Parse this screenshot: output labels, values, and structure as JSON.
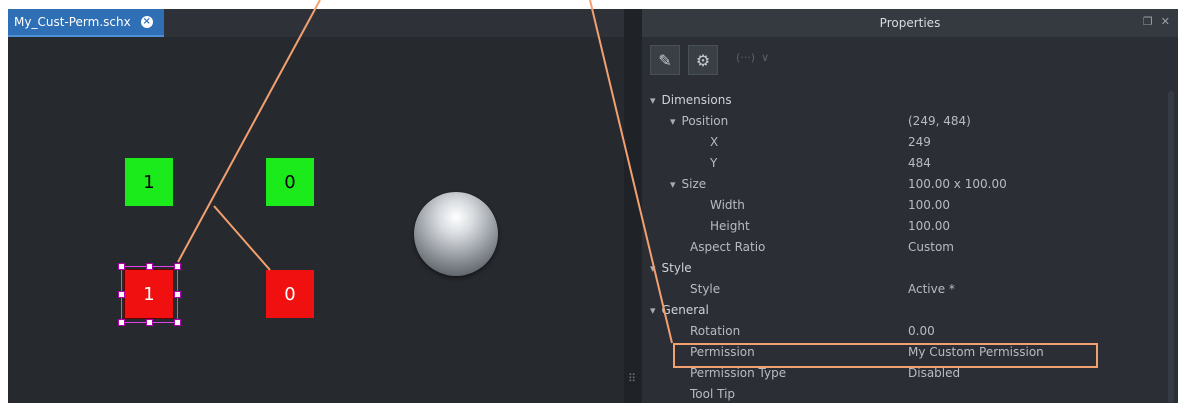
{
  "document_tab": {
    "label": "My_Cust-Perm.schx",
    "close_icon": "close-circle-icon"
  },
  "canvas": {
    "buttons": [
      {
        "label": "1",
        "color": "#1bea1b"
      },
      {
        "label": "0",
        "color": "#1bea1b"
      },
      {
        "label": "1",
        "color": "#f01010",
        "selected": true
      },
      {
        "label": "0",
        "color": "#f01010"
      }
    ],
    "orb_icon": "glass-sphere-icon"
  },
  "properties": {
    "title": "Properties",
    "header_icons": [
      "restore-icon",
      "close-icon"
    ],
    "toolbar": [
      "edit-properties-icon",
      "gear-settings-icon",
      "link-icon",
      "chevron-down-icon"
    ],
    "rows": [
      {
        "id": "dimensions",
        "name": "Dimensions",
        "value": "",
        "expander": "▾",
        "section": true
      },
      {
        "id": "position",
        "name": "Position",
        "value": "(249, 484)",
        "expander": "▾"
      },
      {
        "id": "x",
        "name": "X",
        "value": "249"
      },
      {
        "id": "y",
        "name": "Y",
        "value": "484"
      },
      {
        "id": "size",
        "name": "Size",
        "value": "100.00 x 100.00",
        "expander": "▾"
      },
      {
        "id": "width",
        "name": "Width",
        "value": "100.00"
      },
      {
        "id": "height",
        "name": "Height",
        "value": "100.00"
      },
      {
        "id": "aspect-ratio",
        "name": "Aspect Ratio",
        "value": "Custom"
      },
      {
        "id": "style-section",
        "name": "Style",
        "value": "",
        "expander": "▾",
        "section": true
      },
      {
        "id": "style",
        "name": "Style",
        "value": "Active *"
      },
      {
        "id": "general",
        "name": "General",
        "value": "",
        "expander": "▾",
        "section": true
      },
      {
        "id": "rotation",
        "name": "Rotation",
        "value": "0.00"
      },
      {
        "id": "permission",
        "name": "Permission",
        "value": "My Custom Permission",
        "highlighted": true
      },
      {
        "id": "permission-type",
        "name": "Permission Type",
        "value": "Disabled"
      },
      {
        "id": "tool-tip",
        "name": "Tool Tip",
        "value": ""
      }
    ]
  },
  "colors": {
    "highlight": "#f2a070",
    "selection": "#e840e8",
    "tab_active": "#2f6fb6"
  }
}
